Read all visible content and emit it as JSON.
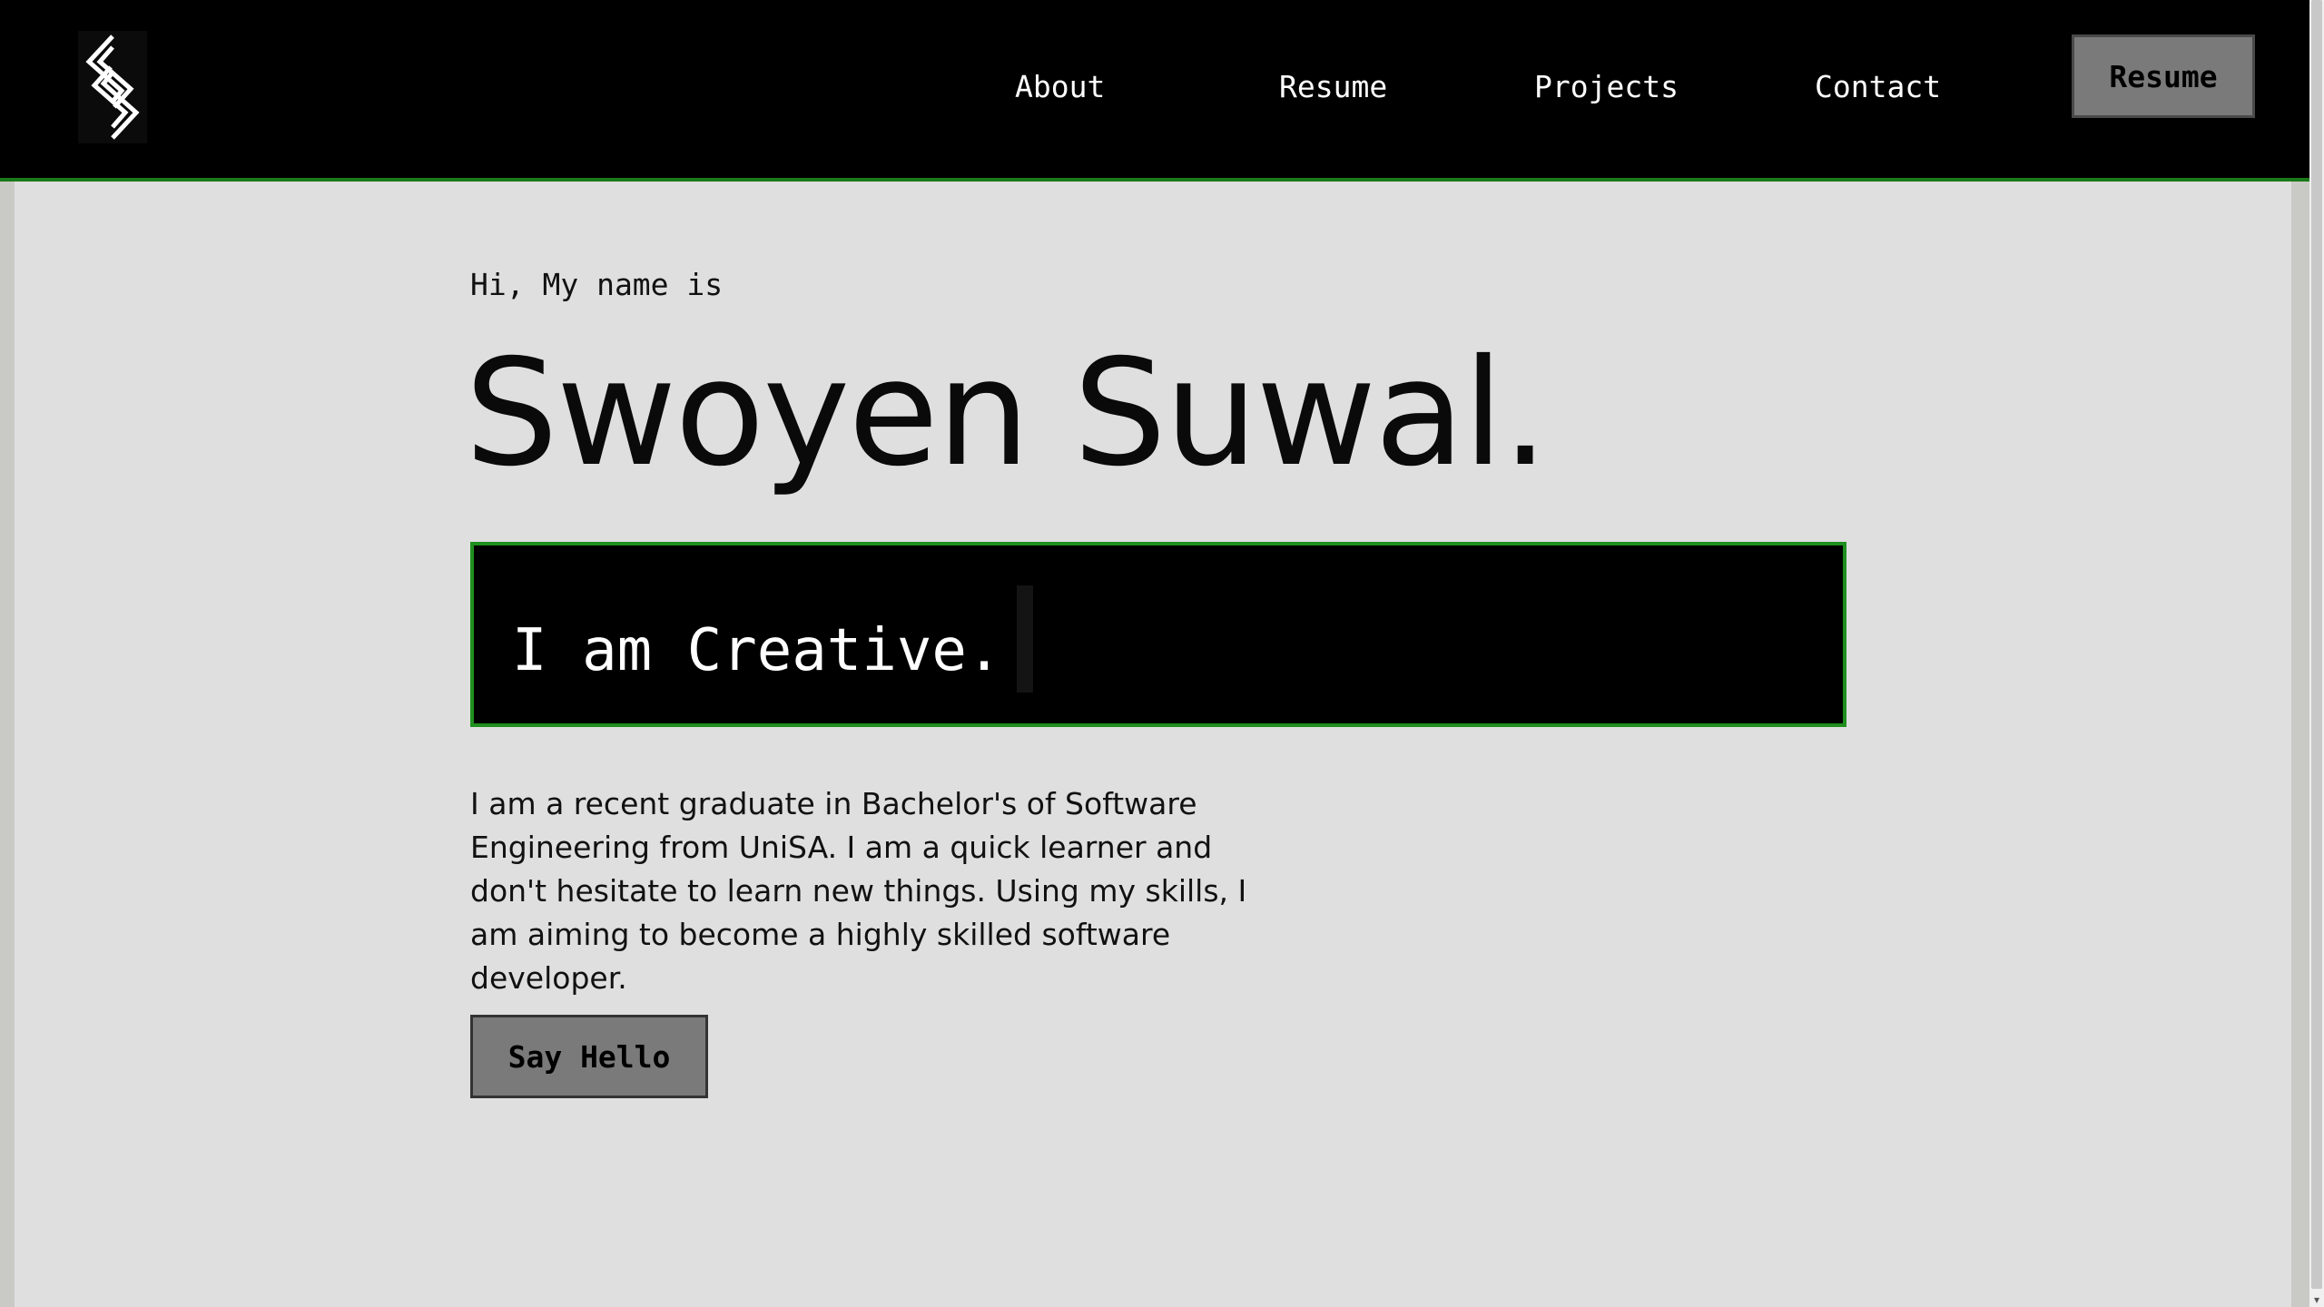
{
  "nav": {
    "logo_icon": "s-diamond-logo-icon",
    "links": [
      {
        "label": "About"
      },
      {
        "label": "Resume"
      },
      {
        "label": "Projects"
      },
      {
        "label": "Contact"
      }
    ],
    "resume_button": "Resume"
  },
  "hero": {
    "greeting": "Hi, My name is",
    "name": "Swoyen Suwal.",
    "typing_text": "I am Creative.",
    "bio": "I am a recent graduate in Bachelor's of Software Engineering from UniSA. I am a quick learner and don't hesitate to learn new things. Using my skills, I am aiming to become a highly skilled software developer.",
    "cta_button": "Say Hello"
  },
  "colors": {
    "accent": "#1f8f1f",
    "nav_background": "#000000",
    "page_background": "#e0dfe0",
    "button_background": "#7a7a7a"
  },
  "scrollbar": {
    "arrow_icon": "chevron-down-icon"
  }
}
